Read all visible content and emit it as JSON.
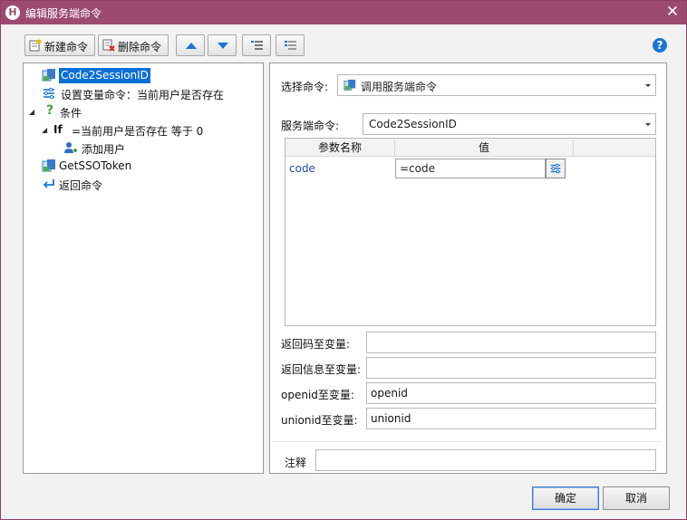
{
  "window": {
    "title": "编辑服务端命令",
    "app_icon": "H"
  },
  "toolbar": {
    "new_label": "新建命令",
    "delete_label": "删除命令",
    "move_up": "up",
    "move_down": "down",
    "indent": "indent",
    "outdent": "outdent"
  },
  "tree": {
    "items": [
      {
        "label": "Code2SessionID",
        "icon": "server-command-icon",
        "selected": true
      },
      {
        "label": "设置变量命令：当前用户是否存在",
        "icon": "set-variable-icon"
      },
      {
        "label": "条件",
        "icon": "question-icon",
        "expander": "◢"
      },
      {
        "prefix": "If",
        "label": "=当前用户是否存在 等于 0",
        "expander": "◢"
      },
      {
        "label": "添加用户",
        "icon": "add-user-icon"
      },
      {
        "label": "GetSSOToken",
        "icon": "server-command-icon"
      },
      {
        "label": "返回命令",
        "icon": "return-icon"
      }
    ]
  },
  "command": {
    "select_label": "选择命令:",
    "select_value": "调用服务端命令",
    "server_label": "服务端命令:",
    "server_value": "Code2SessionID"
  },
  "params": {
    "col_name": "参数名称",
    "col_value": "值",
    "rows": [
      {
        "name": "code",
        "value": "=code"
      }
    ]
  },
  "outputs": {
    "return_code_label": "返回码至变量:",
    "return_code_value": "",
    "return_msg_label": "返回信息至变量:",
    "return_msg_value": "",
    "openid_label": "openid至变量:",
    "openid_value": "openid",
    "unionid_label": "unionid至变量:",
    "unionid_value": "unionid"
  },
  "comment": {
    "label": "注释",
    "value": ""
  },
  "footer": {
    "ok_label": "确定",
    "cancel_label": "取消"
  },
  "colors": {
    "titlebar": "#9c4a72",
    "selection": "#0a70d6",
    "accent": "#1a73d9"
  }
}
